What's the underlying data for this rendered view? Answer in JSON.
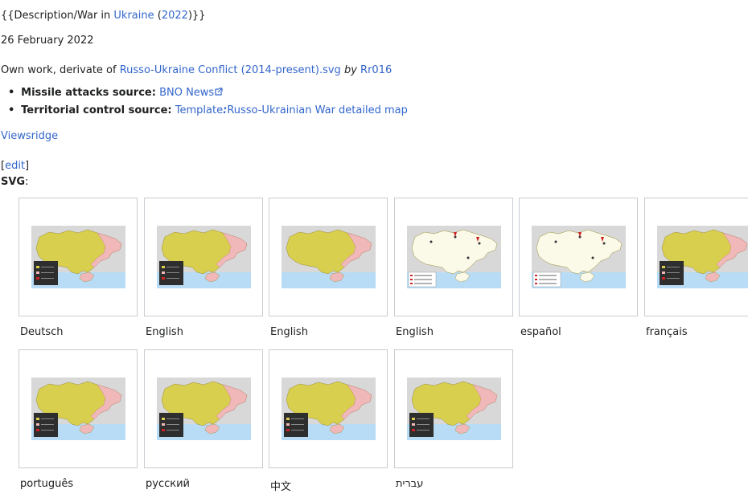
{
  "description": {
    "prefix": "{{Description/War in ",
    "link_ukraine": "Ukraine",
    "paren_open": " (",
    "link_year": "2022",
    "suffix": ")}}"
  },
  "date": "26 February 2022",
  "source": {
    "prefix": "Own work, derivate of ",
    "link_file": "Russo-Ukraine Conflict (2014-present).svg",
    "by": "by",
    "link_author": "Rr016"
  },
  "bullets": [
    {
      "label": "Missile attacks source:",
      "link": "BNO News"
    },
    {
      "label": "Territorial control source:",
      "link_prefix": "Template",
      "link_colon": ":",
      "link": "Russo-Ukrainian War detailed map"
    }
  ],
  "author": "Viewsridge",
  "edit": {
    "open": "[",
    "label": "edit",
    "close": "]"
  },
  "svg_label": {
    "text": "SVG",
    "colon": ":"
  },
  "gallery": [
    {
      "caption": "Deutsch",
      "style": "yellow"
    },
    {
      "caption": "English",
      "style": "yellow"
    },
    {
      "caption": "English",
      "style": "yellow-plain"
    },
    {
      "caption": "English",
      "style": "white"
    },
    {
      "caption": "español",
      "style": "white"
    },
    {
      "caption": "français",
      "style": "yellow"
    },
    {
      "caption": "português",
      "style": "yellow"
    },
    {
      "caption": "русский",
      "style": "yellow"
    },
    {
      "caption": "中文",
      "style": "yellow"
    },
    {
      "caption": "עברית",
      "style": "yellow"
    }
  ],
  "colors": {
    "link": "#3366cc",
    "land_yellow": "#d9cf4e",
    "land_white": "#fbf9e8",
    "occupied": "#f0b8b8",
    "sea": "#b8dcf5",
    "neighbor": "#d8d8d8",
    "legend_dark": "#2e2e2e",
    "marker_red": "#cc2222"
  }
}
